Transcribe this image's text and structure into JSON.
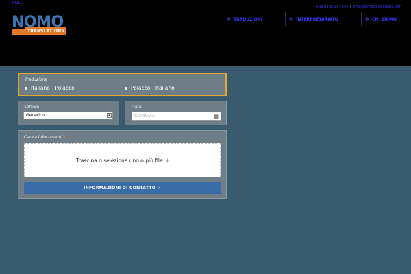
{
  "header": {
    "lang": "POL",
    "phone": "+39 02 8717 7954",
    "email": "info@nomotranslations.com",
    "logo_word": "NOMO",
    "logo_sub": "TRANSLATIONS",
    "nav": [
      {
        "icon": "globe-icon",
        "glyph": "⊕",
        "label": "TRADUZIONI"
      },
      {
        "icon": "mic-icon",
        "glyph": "◎",
        "label": "INTERPRETARIATO"
      },
      {
        "icon": "info-icon",
        "glyph": "⊕",
        "label": "CHI SIAMO"
      }
    ]
  },
  "form": {
    "translation": {
      "label": "Traduzione",
      "required": "*",
      "options": [
        "Italiano - Polacco",
        "Polacco - Italiano"
      ]
    },
    "sector": {
      "label": "Settore",
      "selected": "Generico"
    },
    "date": {
      "label": "Data",
      "placeholder": "GG/MM/AA"
    },
    "documents": {
      "label": "Carica i documenti",
      "required": "*",
      "drop_text": "Trascina o seleziona uno o più file"
    },
    "submit_label": "INFORMAZIONI DI CONTATTO"
  }
}
